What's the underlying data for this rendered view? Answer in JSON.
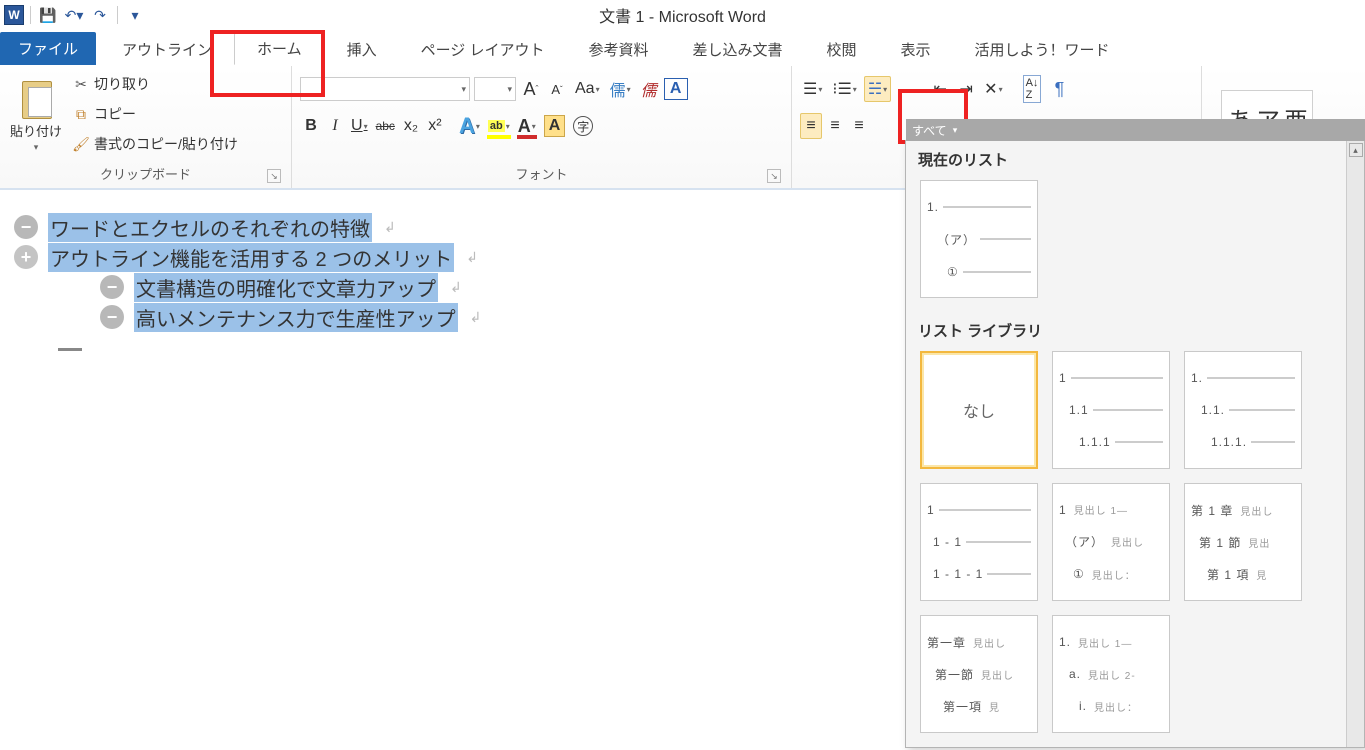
{
  "title": "文書 1 - Microsoft Word",
  "qat": {
    "save_tip": "保存",
    "undo_tip": "元に戻す",
    "redo_tip": "やり直し"
  },
  "tabs": {
    "file": "ファイル",
    "outline": "アウトライン",
    "home": "ホーム",
    "insert": "挿入",
    "page_layout": "ページ レイアウト",
    "references": "参考資料",
    "mailings": "差し込み文書",
    "review": "校閲",
    "view": "表示",
    "addins": "活用しよう！ワード"
  },
  "clipboard": {
    "paste": "貼り付け",
    "cut": "切り取り",
    "copy": "コピー",
    "format_painter": "書式のコピー/貼り付け",
    "group_label": "クリップボード"
  },
  "font": {
    "group_label": "フォント",
    "grow_label": "A",
    "shrink_label": "A",
    "change_case": "Aa",
    "bold": "B",
    "italic": "I",
    "underline": "U",
    "strike": "abc",
    "subscript": "x₂",
    "superscript": "x²",
    "text_effects": "A",
    "highlight_label": "ab",
    "font_color": "A",
    "char_shading": "A",
    "enclose": "㊞",
    "phonetic": "儒"
  },
  "paragraph": {
    "sort": "A→Z",
    "show_marks": "¶"
  },
  "styles": {
    "preview_text": "あア亜"
  },
  "multilevel": {
    "header_bar": "すべて",
    "section_current": "現在のリスト",
    "section_library": "リスト ライブラリ",
    "current_item": {
      "l1": "1.",
      "l2": "（ア）",
      "l3": "①"
    },
    "none_label": "なし",
    "lib": [
      {
        "l1": "1",
        "l2": "1.1",
        "l3": "1.1.1"
      },
      {
        "l1": "1.",
        "l2": "1.1.",
        "l3": "1.1.1."
      },
      {
        "l1": "1",
        "l2": "1 - 1",
        "l3": "1 - 1 - 1"
      },
      {
        "l1": "1",
        "l1s": "見出し 1—",
        "l2": "（ア）",
        "l2s": "見出し",
        "l3": "①",
        "l3s": "見出し："
      },
      {
        "l1": "第 1 章",
        "l1s": "見出し",
        "l2": "第 1 節",
        "l2s": "見出",
        "l3": "第 1 項",
        "l3s": "見"
      },
      {
        "l1": "第一章",
        "l1s": "見出し",
        "l2": "第一節",
        "l2s": "見出し",
        "l3": "第一項",
        "l3s": "見"
      },
      {
        "l1": "1.",
        "l1s": "見出し 1—",
        "l2": "a.",
        "l2s": "見出し 2-",
        "l3": "i.",
        "l3s": "見出し："
      }
    ]
  },
  "doc": {
    "line1": "ワードとエクセルのそれぞれの特徴",
    "line2": "アウトライン機能を活用する 2 つのメリット",
    "line3": "文書構造の明確化で文章力アップ",
    "line4": "高いメンテナンス力で生産性アップ"
  }
}
